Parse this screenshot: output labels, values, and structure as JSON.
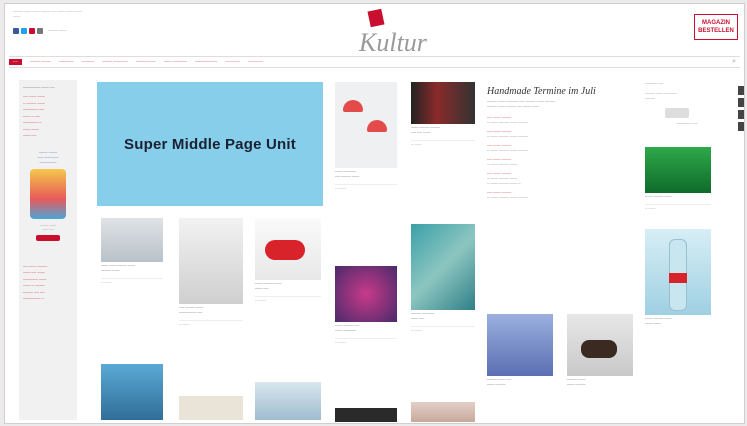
{
  "ad": {
    "label": "Super Middle Page Unit"
  },
  "colors": {
    "accent": "#c8102e",
    "ad_bg": "#87ceeb",
    "ad_text": "#1a2232"
  }
}
